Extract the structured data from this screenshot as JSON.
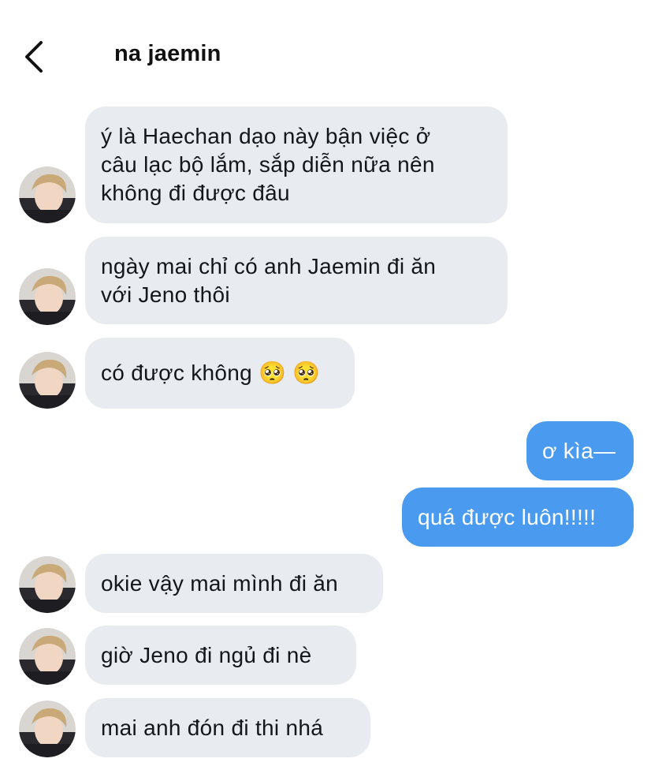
{
  "header": {
    "contact_name": "na jaemin"
  },
  "colors": {
    "incoming_bubble": "#e8ecf0",
    "outgoing_bubble": "#4a9bf0",
    "incoming_text": "#141619",
    "outgoing_text": "#ffffff"
  },
  "messages": [
    {
      "from": "them",
      "text": "ý là Haechan dạo này bận việc ở\ncâu lạc bộ lắm, sắp diễn nữa nên\nkhông đi được đâu"
    },
    {
      "from": "them",
      "text": "ngày mai chỉ có anh Jaemin đi ăn\nvới Jeno thôi"
    },
    {
      "from": "them",
      "text": "có được không 🥺 🥺"
    },
    {
      "from": "me",
      "text": "ơ kìa—"
    },
    {
      "from": "me",
      "text": "quá được luôn!!!!!"
    },
    {
      "from": "them",
      "text": "okie vậy mai mình đi ăn"
    },
    {
      "from": "them",
      "text": "giờ Jeno đi ngủ đi nè"
    },
    {
      "from": "them",
      "text": "mai anh đón đi thi nhá"
    }
  ]
}
